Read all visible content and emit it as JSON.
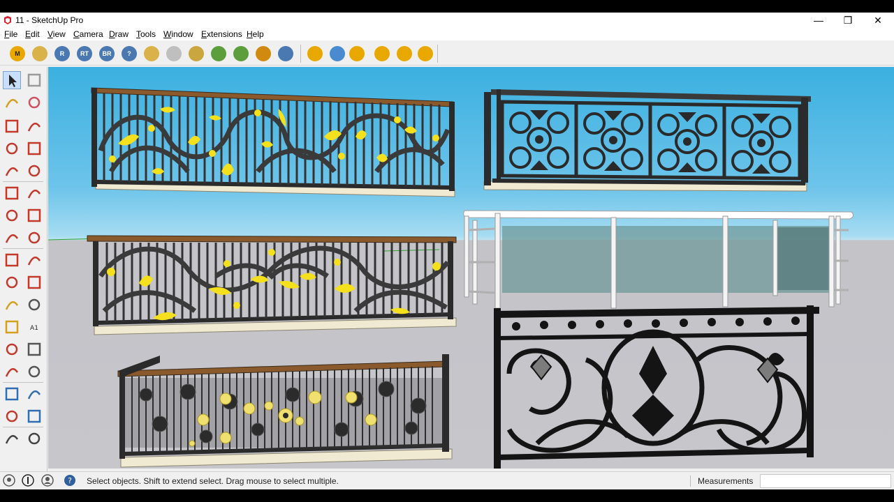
{
  "window": {
    "title": "11 - SketchUp Pro",
    "minimize": "—",
    "restore": "❐",
    "close": "✕"
  },
  "menu": [
    "File",
    "Edit",
    "View",
    "Camera",
    "Draw",
    "Tools",
    "Window",
    "Extensions",
    "Help"
  ],
  "toolbar": {
    "buttons": [
      {
        "label": "M",
        "icon": "m-plugin-icon",
        "color": "#e8a800"
      },
      {
        "label": "",
        "icon": "tag-icon",
        "color": "#d9b24a"
      },
      {
        "label": "R",
        "icon": "r-plugin-icon",
        "color": "#4a78b0"
      },
      {
        "label": "RT",
        "icon": "rt-plugin-icon",
        "color": "#4a78b0"
      },
      {
        "label": "BR",
        "icon": "br-plugin-icon",
        "color": "#4a78b0"
      },
      {
        "label": "?",
        "icon": "help-plugin-icon",
        "color": "#4a78b0"
      },
      {
        "label": "",
        "icon": "tag-edit-icon",
        "color": "#d9b24a"
      },
      {
        "label": "",
        "icon": "sphere-icon",
        "color": "#bfbfbf"
      },
      {
        "label": "",
        "icon": "layers-icon",
        "color": "#c9a640"
      },
      {
        "label": "",
        "icon": "tree-icon",
        "color": "#5c9e3c"
      },
      {
        "label": "",
        "icon": "tree-add-icon",
        "color": "#5c9e3c"
      },
      {
        "label": "",
        "icon": "target-icon",
        "color": "#d08a10"
      },
      {
        "label": "",
        "icon": "pause-icon",
        "color": "#4a78b0"
      },
      {
        "label": "",
        "icon": "sun-dot-icon",
        "color": "#e8a800"
      },
      {
        "label": "",
        "icon": "lamp-icon",
        "color": "#4a8ad0"
      },
      {
        "label": "",
        "icon": "spot-light-icon",
        "color": "#e8a800"
      },
      {
        "label": "",
        "icon": "dome-light-icon",
        "color": "#e8a800"
      },
      {
        "label": "",
        "icon": "sphere-light-icon",
        "color": "#e8a800"
      },
      {
        "label": "",
        "icon": "light-edit-icon",
        "color": "#e8a800"
      }
    ]
  },
  "left_tools": [
    {
      "icon": "select-arrow-icon",
      "selected": true
    },
    {
      "icon": "make-component-icon"
    },
    {
      "icon": "paint-bucket-icon"
    },
    {
      "icon": "eraser-icon"
    },
    {
      "icon": "line-pencil-icon"
    },
    {
      "icon": "freehand-icon"
    },
    {
      "icon": "rectangle-icon"
    },
    {
      "icon": "rotated-rectangle-icon"
    },
    {
      "icon": "circle-icon"
    },
    {
      "icon": "polygon-icon"
    },
    {
      "icon": "arc-icon"
    },
    {
      "icon": "two-point-arc-icon"
    },
    {
      "icon": "three-point-arc-icon"
    },
    {
      "icon": "pie-icon"
    },
    {
      "icon": "move-icon"
    },
    {
      "icon": "push-pull-icon"
    },
    {
      "icon": "rotate-icon"
    },
    {
      "icon": "follow-me-icon"
    },
    {
      "icon": "scale-icon"
    },
    {
      "icon": "offset-icon"
    },
    {
      "icon": "tape-measure-icon"
    },
    {
      "icon": "dimension-icon"
    },
    {
      "icon": "protractor-icon"
    },
    {
      "icon": "text-icon"
    },
    {
      "icon": "axes-icon"
    },
    {
      "icon": "3d-text-icon"
    },
    {
      "icon": "orbit-icon"
    },
    {
      "icon": "pan-icon"
    },
    {
      "icon": "zoom-icon"
    },
    {
      "icon": "zoom-window-icon"
    },
    {
      "icon": "zoom-extents-icon"
    },
    {
      "icon": "previous-view-icon"
    },
    {
      "icon": "walk-icon"
    },
    {
      "icon": "look-around-icon"
    }
  ],
  "text_label_icon": "A1",
  "status": {
    "hint": "Select objects. Shift to extend select. Drag mouse to select multiple.",
    "measurements_label": "Measurements",
    "measurements_value": ""
  }
}
